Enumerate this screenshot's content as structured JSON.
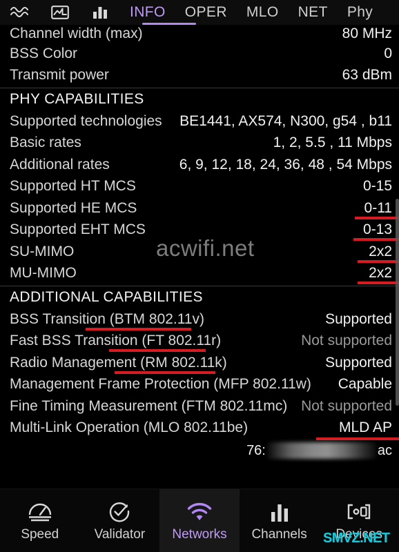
{
  "tabs": {
    "icons": [
      {
        "name": "waveform-icon"
      },
      {
        "name": "chart-box-icon"
      },
      {
        "name": "bar-chart-icon"
      }
    ],
    "items": [
      {
        "label": "INFO",
        "active": true
      },
      {
        "label": "OPER",
        "active": false
      },
      {
        "label": "MLO",
        "active": false
      },
      {
        "label": "NET",
        "active": false
      },
      {
        "label": "Phy",
        "active": false
      }
    ],
    "accent_color": "#b388f5"
  },
  "list": {
    "top_rows": [
      {
        "label": "Channel width (max)",
        "value": "80 MHz"
      },
      {
        "label": "BSS Color",
        "value": "0"
      },
      {
        "label": "Transmit power",
        "value": "63 dBm"
      }
    ],
    "phy_section_title": "PHY CAPABILITIES",
    "phy_rows": [
      {
        "label": "Supported technologies",
        "value": "BE1441, AX574, N300, g54 , b11"
      },
      {
        "label": "Basic rates",
        "value": "1, 2, 5.5 , 11 Mbps"
      },
      {
        "label": "Additional rates",
        "value": "6, 9, 12, 18, 24, 36, 48 , 54 Mbps"
      },
      {
        "label": "Supported HT MCS",
        "value": "0-15"
      },
      {
        "label": "Supported HE MCS",
        "value": "0-11"
      },
      {
        "label": "Supported EHT MCS",
        "value": "0-13"
      },
      {
        "label": "SU-MIMO",
        "value": "2x2"
      },
      {
        "label": "MU-MIMO",
        "value": "2x2"
      }
    ],
    "additional_section_title": "ADDITIONAL CAPABILITIES",
    "additional_rows": [
      {
        "label": "BSS Transition (BTM 802.11v)",
        "value": "Supported"
      },
      {
        "label": "Fast BSS Transition (FT 802.11r)",
        "value": "Not supported"
      },
      {
        "label": "Radio Management (RM 802.11k)",
        "value": "Supported"
      },
      {
        "label": "Management Frame Protection (MFP 802.11w)",
        "value": "Capable"
      },
      {
        "label": "Fine Timing Measurement (FTM 802.11mc)",
        "value": "Not supported"
      },
      {
        "label": "Multi-Link Operation (MLO 802.11be)",
        "value": "MLD AP"
      }
    ],
    "mac_row": {
      "prefix": "76:",
      "suffix": "ac"
    },
    "annotation_color": "#d61b22"
  },
  "watermarks": {
    "center": "acwifi.net",
    "corner": "SMVZ.NET"
  },
  "bottomnav": {
    "items": [
      {
        "label": "Speed",
        "icon": "speedometer-icon",
        "active": false
      },
      {
        "label": "Validator",
        "icon": "check-circle-icon",
        "active": false
      },
      {
        "label": "Networks",
        "icon": "wifi-icon",
        "active": true
      },
      {
        "label": "Channels",
        "icon": "bar-chart-icon",
        "active": false
      },
      {
        "label": "Devices",
        "icon": "devices-icon",
        "active": false
      }
    ]
  }
}
